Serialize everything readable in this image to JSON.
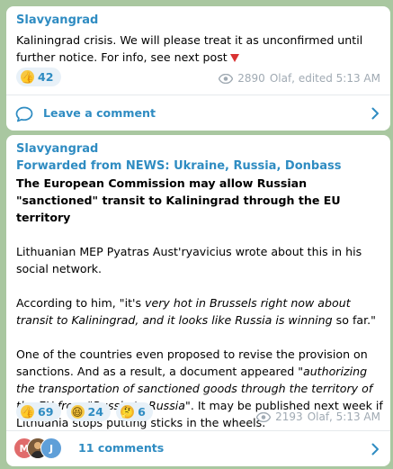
{
  "post1": {
    "channel": "Slavyangrad",
    "text": "Kaliningrad crisis. We will please treat it as unconfirmed until further notice. For info, see next post",
    "reactions": [
      {
        "emoji": "thumbs-up-icon",
        "count": "42"
      }
    ],
    "views": "2890",
    "meta": "Olaf, edited 5:13 AM",
    "comment_label": "Leave a comment"
  },
  "post2": {
    "channel": "Slavyangrad",
    "forwarded": "Forwarded from NEWS: Ukraine, Russia, Donbass",
    "headline": "The European Commission may allow Russian \"sanctioned\" transit to Kaliningrad through the EU territory",
    "para1": "Lithuanian MEP Pyatras Aust'ryavicius wrote about this in his social network.",
    "para2_start": "According to him, \"it's ",
    "para2_italic": "very hot in Brussels right now about transit to Kaliningrad, and it looks like Russia is winning",
    "para2_end": " so far.\"",
    "para3_start": "One of the countries even proposed to revise the provision on sanctions. And as a result, a document appeared \"",
    "para3_italic1": "authorizing the transportation of sanctioned goods through the territory of the EU from \"Russia to Russia",
    "para3_end": "\". It may be published next week if Lithuania stops putting sticks in the wheels.",
    "reactions": [
      {
        "emoji": "thumbs-up-icon",
        "count": "69"
      },
      {
        "emoji": "laughing-face-icon",
        "count": "24"
      },
      {
        "emoji": "thinking-face-icon",
        "count": "6"
      }
    ],
    "views": "2193",
    "meta": "Olaf, 5:13 AM",
    "comment_label": "11 comments",
    "avatars": [
      {
        "initial": "M",
        "color": "#e06b6b"
      },
      {
        "initial": "",
        "color": "#7a5a3a"
      },
      {
        "initial": "J",
        "color": "#5f9fd8"
      }
    ]
  },
  "colors": {
    "background": "#a9c7a0",
    "accent": "#2f8cc2",
    "meta": "#a0aab3"
  }
}
